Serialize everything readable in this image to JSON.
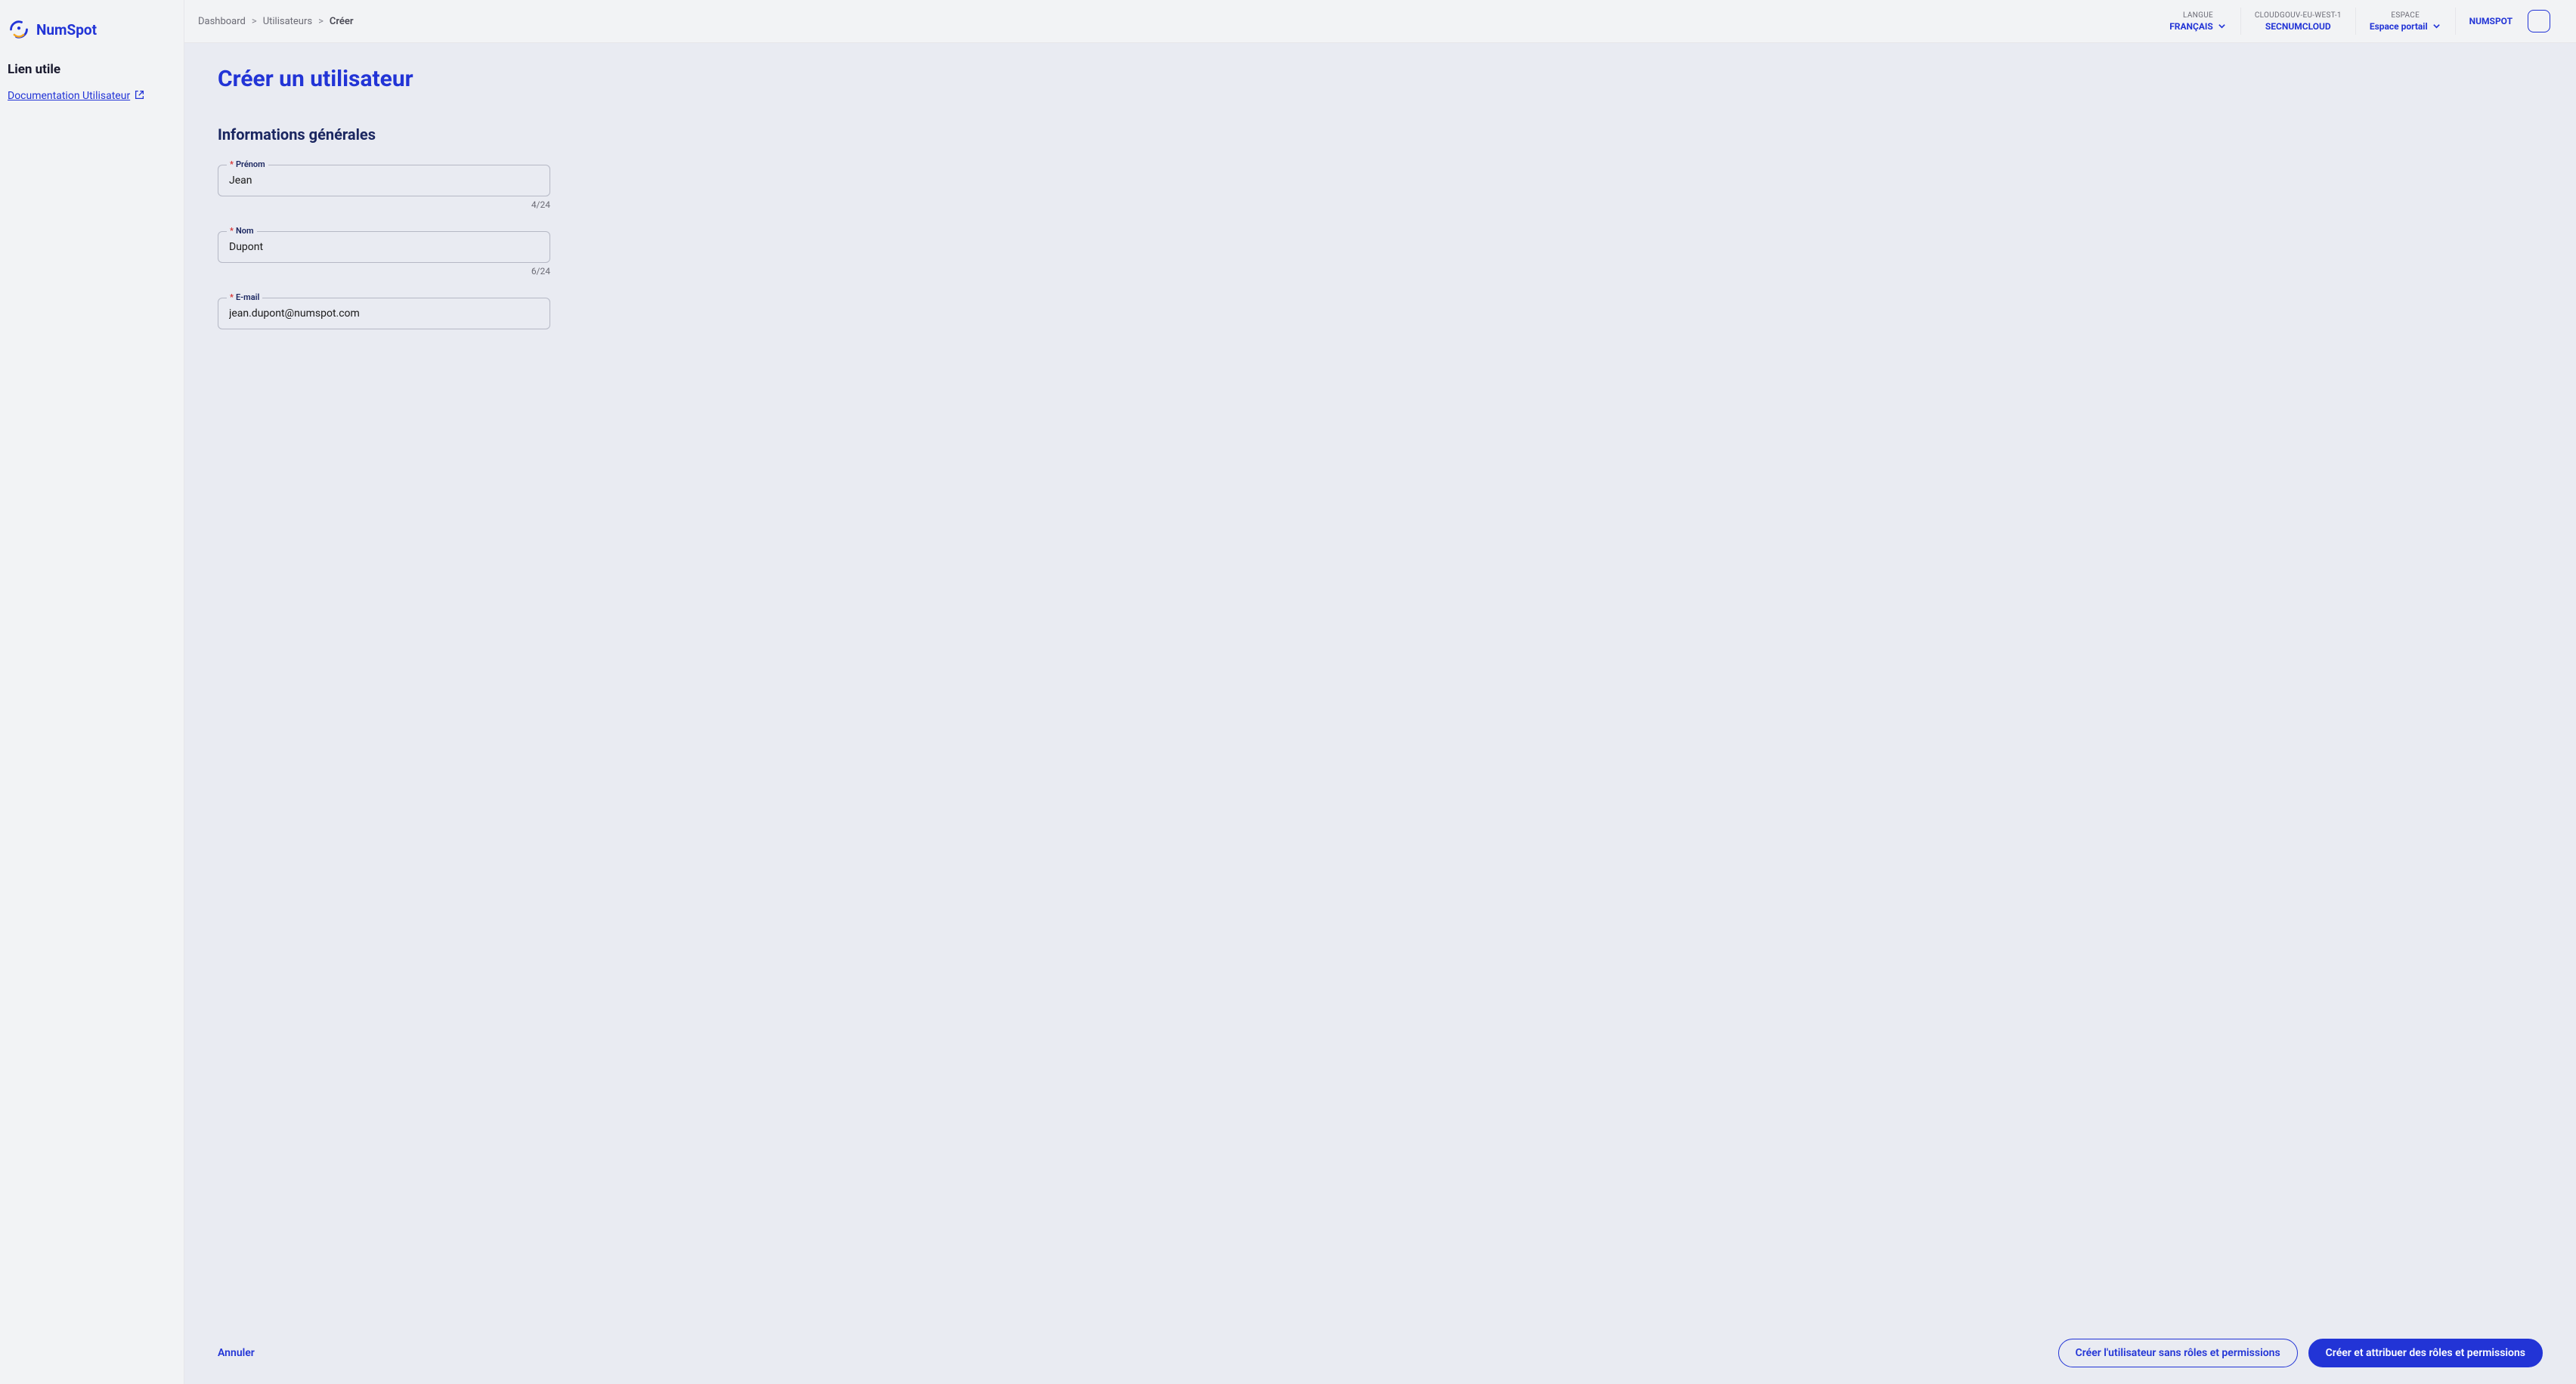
{
  "brand": {
    "name": "NumSpot"
  },
  "sidebar": {
    "section_title": "Lien utile",
    "doc_link_label": "Documentation Utilisateur"
  },
  "breadcrumbs": {
    "items": [
      "Dashboard",
      "Utilisateurs"
    ],
    "current": "Créer",
    "separator": ">"
  },
  "topbar": {
    "language": {
      "label": "LANGUE",
      "value": "FRANÇAIS"
    },
    "region": {
      "label": "CLOUDGOUV-EU-WEST-1",
      "value": "SECNUMCLOUD"
    },
    "space": {
      "label": "ESPACE",
      "value": "Espace portail"
    },
    "org": {
      "value": "NUMSPOT"
    }
  },
  "page": {
    "title": "Créer un utilisateur",
    "section_title": "Informations générales"
  },
  "form": {
    "firstname": {
      "label": "Prénom",
      "value": "Jean",
      "counter": "4/24"
    },
    "lastname": {
      "label": "Nom",
      "value": "Dupont",
      "counter": "6/24"
    },
    "email": {
      "label": "E-mail",
      "value": "jean.dupont@numspot.com"
    }
  },
  "footer": {
    "cancel": "Annuler",
    "create_no_roles": "Créer l'utilisateur sans rôles et permissions",
    "create_with_roles": "Créer et attribuer des rôles et permissions"
  }
}
